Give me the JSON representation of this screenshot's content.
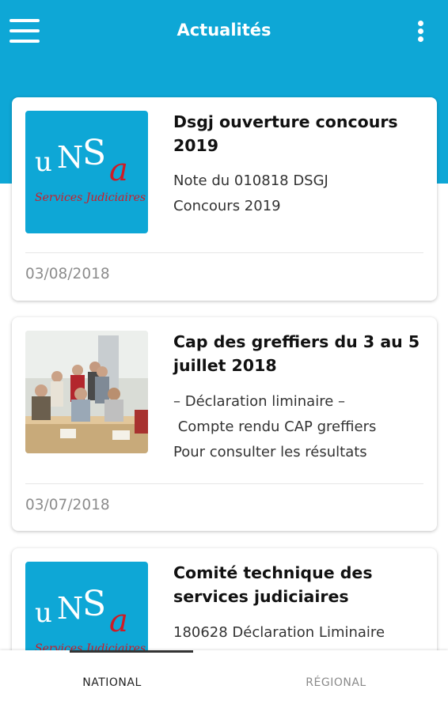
{
  "app_bar": {
    "title": "Actualités",
    "menu_icon": "hamburger-menu-icon",
    "more_icon": "more-vertical-icon"
  },
  "colors": {
    "primary": "#0ea7d6",
    "logo_red": "#d01a24",
    "logo_white": "#ffffff"
  },
  "articles": [
    {
      "thumbnail": "unsa-services-judiciaires-logo",
      "logo_top_letters": [
        "u",
        "N",
        "S",
        "a"
      ],
      "logo_script": "Services Judiciaires",
      "title": "Dsgj ouverture concours 2019",
      "excerpt_lines": [
        "Note du 010818 DSGJ",
        "Concours 2019"
      ],
      "date": "03/08/2018"
    },
    {
      "thumbnail": "group-photo",
      "title": "Cap des greffiers du 3 au 5 juillet 2018",
      "excerpt_lines": [
        "– Déclaration liminaire –",
        " Compte rendu CAP greffiers",
        "Pour consulter les résultats"
      ],
      "date": "03/07/2018"
    },
    {
      "thumbnail": "unsa-services-judiciaires-logo",
      "logo_top_letters": [
        "u",
        "N",
        "S",
        "a"
      ],
      "logo_script": "Services Judiciaires",
      "title": "Comité technique des services judiciaires",
      "excerpt_lines": [
        "180628 Déclaration Liminaire"
      ]
    }
  ],
  "bottom_nav": {
    "tabs": [
      {
        "label": "NATIONAL",
        "selected": true
      },
      {
        "label": "RÉGIONAL",
        "selected": false
      }
    ]
  }
}
